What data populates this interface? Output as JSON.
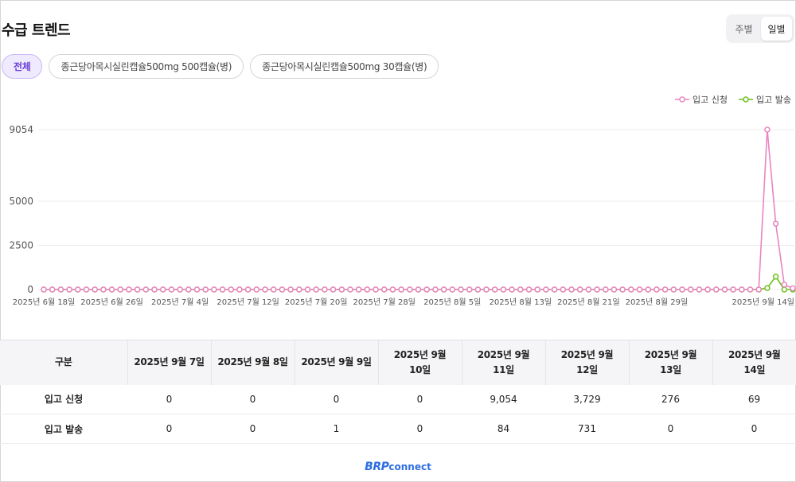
{
  "header": {
    "title": "수급 트렌드",
    "toggle": [
      {
        "label": "주별",
        "active": false
      },
      {
        "label": "일별",
        "active": true
      }
    ]
  },
  "filters": [
    {
      "label": "전체",
      "active": true
    },
    {
      "label": "종근당아목시실린캡슐500mg 500캡슐(병)",
      "active": false
    },
    {
      "label": "종근당아목시실린캡슐500mg 30캡슐(병)",
      "active": false
    }
  ],
  "chart_data": {
    "type": "line",
    "yticks": [
      0,
      2500,
      5000,
      9054
    ],
    "ylim": [
      0,
      9054
    ],
    "xtick_labels": [
      "2025년 6월 18일",
      "2025년 6월 26일",
      "2025년 7월 4일",
      "2025년 7월 12일",
      "2025년 7월 20일",
      "2025년 7월 28일",
      "2025년 8월 5일",
      "2025년 8월 13일",
      "2025년 8월 21일",
      "2025년 8월 29일",
      "2025년 9월 14일"
    ],
    "x_start": "2025-06-18",
    "x_end": "2025-09-14",
    "legend_position": "top-right",
    "series": [
      {
        "name": "입고 신청",
        "color": "#e985c0",
        "values": [
          0,
          0,
          0,
          0,
          0,
          0,
          0,
          0,
          0,
          0,
          0,
          0,
          0,
          0,
          0,
          0,
          0,
          0,
          0,
          0,
          0,
          0,
          0,
          0,
          0,
          0,
          0,
          0,
          0,
          0,
          0,
          0,
          0,
          0,
          0,
          0,
          0,
          0,
          0,
          0,
          0,
          0,
          0,
          0,
          0,
          0,
          0,
          0,
          0,
          0,
          0,
          0,
          0,
          0,
          0,
          0,
          0,
          0,
          0,
          0,
          0,
          0,
          0,
          0,
          0,
          0,
          0,
          0,
          0,
          0,
          0,
          0,
          0,
          0,
          0,
          0,
          0,
          0,
          0,
          0,
          0,
          0,
          0,
          0,
          0,
          9054,
          3729,
          276,
          69
        ]
      },
      {
        "name": "입고 발송",
        "color": "#6cc21c",
        "values": [
          0,
          0,
          0,
          0,
          0,
          0,
          0,
          0,
          0,
          0,
          0,
          0,
          0,
          0,
          0,
          0,
          0,
          0,
          0,
          0,
          0,
          0,
          0,
          0,
          0,
          0,
          0,
          0,
          0,
          0,
          0,
          0,
          0,
          0,
          0,
          0,
          0,
          0,
          0,
          0,
          0,
          0,
          0,
          0,
          0,
          0,
          0,
          0,
          0,
          0,
          0,
          0,
          0,
          0,
          0,
          0,
          0,
          0,
          0,
          0,
          0,
          0,
          0,
          0,
          0,
          0,
          0,
          0,
          0,
          0,
          0,
          0,
          0,
          0,
          0,
          0,
          0,
          0,
          0,
          0,
          0,
          0,
          0,
          1,
          0,
          84,
          731,
          0,
          0
        ]
      }
    ]
  },
  "table": {
    "corner": "구분",
    "columns": [
      [
        "2025년 9월 7일"
      ],
      [
        "2025년 9월 8일"
      ],
      [
        "2025년 9월 9일"
      ],
      [
        "2025년 9월",
        "10일"
      ],
      [
        "2025년 9월",
        "11일"
      ],
      [
        "2025년 9월",
        "12일"
      ],
      [
        "2025년 9월",
        "13일"
      ],
      [
        "2025년 9월",
        "14일"
      ]
    ],
    "rows": [
      {
        "label": "입고 신청",
        "values": [
          "0",
          "0",
          "0",
          "0",
          "9,054",
          "3,729",
          "276",
          "69"
        ]
      },
      {
        "label": "입고 발송",
        "values": [
          "0",
          "0",
          "1",
          "0",
          "84",
          "731",
          "0",
          "0"
        ]
      }
    ]
  },
  "footer": {
    "logo_brp": "BRP",
    "logo_connect": "connect"
  }
}
